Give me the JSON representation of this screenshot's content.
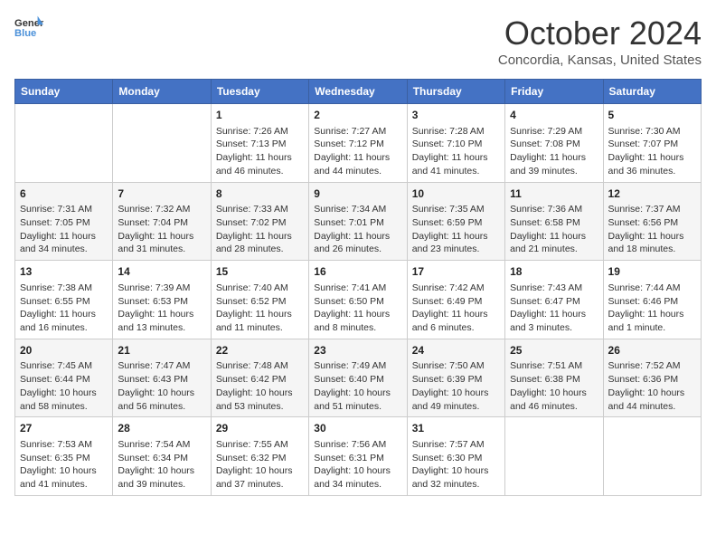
{
  "header": {
    "logo_general": "General",
    "logo_blue": "Blue",
    "month": "October 2024",
    "location": "Concordia, Kansas, United States"
  },
  "days_of_week": [
    "Sunday",
    "Monday",
    "Tuesday",
    "Wednesday",
    "Thursday",
    "Friday",
    "Saturday"
  ],
  "weeks": [
    [
      {
        "day": "",
        "content": ""
      },
      {
        "day": "",
        "content": ""
      },
      {
        "day": "1",
        "content": "Sunrise: 7:26 AM\nSunset: 7:13 PM\nDaylight: 11 hours and 46 minutes."
      },
      {
        "day": "2",
        "content": "Sunrise: 7:27 AM\nSunset: 7:12 PM\nDaylight: 11 hours and 44 minutes."
      },
      {
        "day": "3",
        "content": "Sunrise: 7:28 AM\nSunset: 7:10 PM\nDaylight: 11 hours and 41 minutes."
      },
      {
        "day": "4",
        "content": "Sunrise: 7:29 AM\nSunset: 7:08 PM\nDaylight: 11 hours and 39 minutes."
      },
      {
        "day": "5",
        "content": "Sunrise: 7:30 AM\nSunset: 7:07 PM\nDaylight: 11 hours and 36 minutes."
      }
    ],
    [
      {
        "day": "6",
        "content": "Sunrise: 7:31 AM\nSunset: 7:05 PM\nDaylight: 11 hours and 34 minutes."
      },
      {
        "day": "7",
        "content": "Sunrise: 7:32 AM\nSunset: 7:04 PM\nDaylight: 11 hours and 31 minutes."
      },
      {
        "day": "8",
        "content": "Sunrise: 7:33 AM\nSunset: 7:02 PM\nDaylight: 11 hours and 28 minutes."
      },
      {
        "day": "9",
        "content": "Sunrise: 7:34 AM\nSunset: 7:01 PM\nDaylight: 11 hours and 26 minutes."
      },
      {
        "day": "10",
        "content": "Sunrise: 7:35 AM\nSunset: 6:59 PM\nDaylight: 11 hours and 23 minutes."
      },
      {
        "day": "11",
        "content": "Sunrise: 7:36 AM\nSunset: 6:58 PM\nDaylight: 11 hours and 21 minutes."
      },
      {
        "day": "12",
        "content": "Sunrise: 7:37 AM\nSunset: 6:56 PM\nDaylight: 11 hours and 18 minutes."
      }
    ],
    [
      {
        "day": "13",
        "content": "Sunrise: 7:38 AM\nSunset: 6:55 PM\nDaylight: 11 hours and 16 minutes."
      },
      {
        "day": "14",
        "content": "Sunrise: 7:39 AM\nSunset: 6:53 PM\nDaylight: 11 hours and 13 minutes."
      },
      {
        "day": "15",
        "content": "Sunrise: 7:40 AM\nSunset: 6:52 PM\nDaylight: 11 hours and 11 minutes."
      },
      {
        "day": "16",
        "content": "Sunrise: 7:41 AM\nSunset: 6:50 PM\nDaylight: 11 hours and 8 minutes."
      },
      {
        "day": "17",
        "content": "Sunrise: 7:42 AM\nSunset: 6:49 PM\nDaylight: 11 hours and 6 minutes."
      },
      {
        "day": "18",
        "content": "Sunrise: 7:43 AM\nSunset: 6:47 PM\nDaylight: 11 hours and 3 minutes."
      },
      {
        "day": "19",
        "content": "Sunrise: 7:44 AM\nSunset: 6:46 PM\nDaylight: 11 hours and 1 minute."
      }
    ],
    [
      {
        "day": "20",
        "content": "Sunrise: 7:45 AM\nSunset: 6:44 PM\nDaylight: 10 hours and 58 minutes."
      },
      {
        "day": "21",
        "content": "Sunrise: 7:47 AM\nSunset: 6:43 PM\nDaylight: 10 hours and 56 minutes."
      },
      {
        "day": "22",
        "content": "Sunrise: 7:48 AM\nSunset: 6:42 PM\nDaylight: 10 hours and 53 minutes."
      },
      {
        "day": "23",
        "content": "Sunrise: 7:49 AM\nSunset: 6:40 PM\nDaylight: 10 hours and 51 minutes."
      },
      {
        "day": "24",
        "content": "Sunrise: 7:50 AM\nSunset: 6:39 PM\nDaylight: 10 hours and 49 minutes."
      },
      {
        "day": "25",
        "content": "Sunrise: 7:51 AM\nSunset: 6:38 PM\nDaylight: 10 hours and 46 minutes."
      },
      {
        "day": "26",
        "content": "Sunrise: 7:52 AM\nSunset: 6:36 PM\nDaylight: 10 hours and 44 minutes."
      }
    ],
    [
      {
        "day": "27",
        "content": "Sunrise: 7:53 AM\nSunset: 6:35 PM\nDaylight: 10 hours and 41 minutes."
      },
      {
        "day": "28",
        "content": "Sunrise: 7:54 AM\nSunset: 6:34 PM\nDaylight: 10 hours and 39 minutes."
      },
      {
        "day": "29",
        "content": "Sunrise: 7:55 AM\nSunset: 6:32 PM\nDaylight: 10 hours and 37 minutes."
      },
      {
        "day": "30",
        "content": "Sunrise: 7:56 AM\nSunset: 6:31 PM\nDaylight: 10 hours and 34 minutes."
      },
      {
        "day": "31",
        "content": "Sunrise: 7:57 AM\nSunset: 6:30 PM\nDaylight: 10 hours and 32 minutes."
      },
      {
        "day": "",
        "content": ""
      },
      {
        "day": "",
        "content": ""
      }
    ]
  ]
}
